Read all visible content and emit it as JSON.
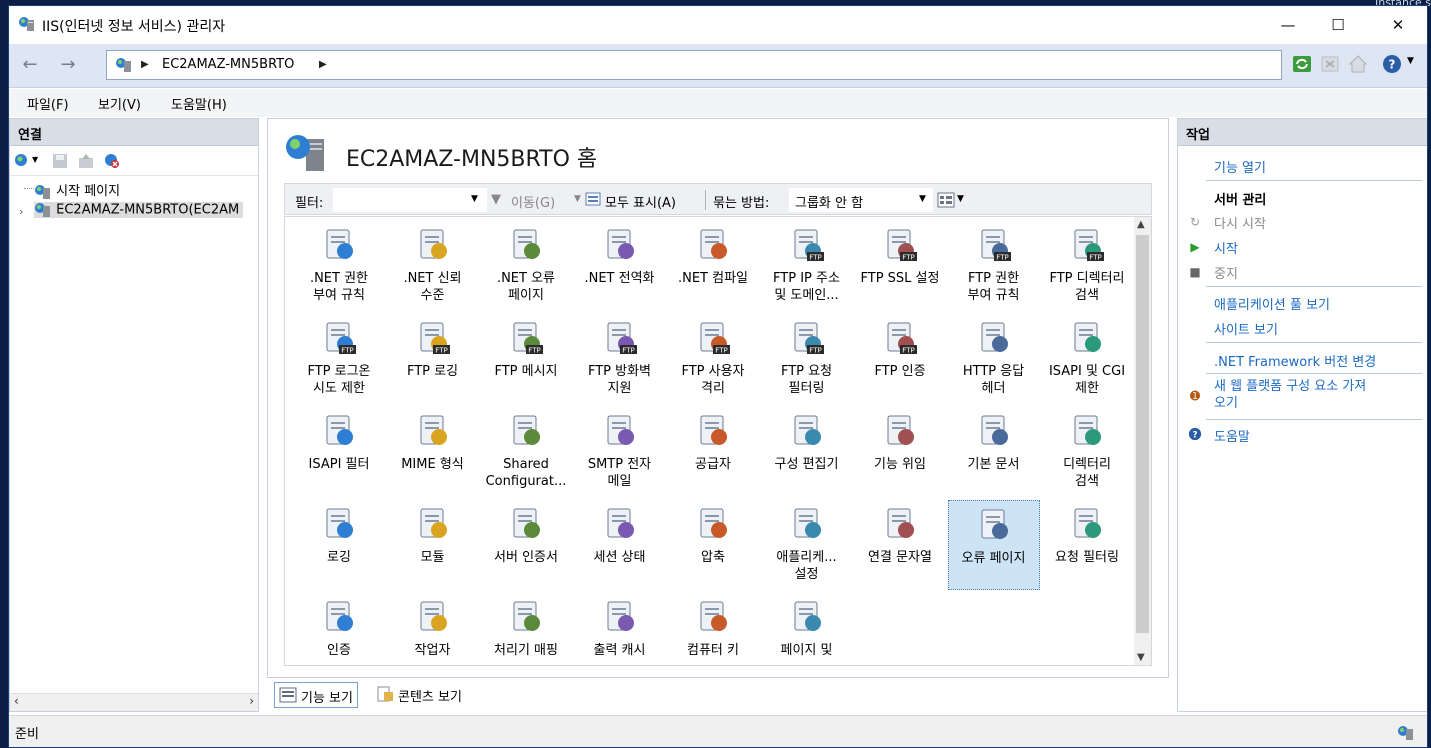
{
  "desktop": {
    "corner_text": "Instance s"
  },
  "window": {
    "title": "IIS(인터넷 정보 서비스) 관리자",
    "controls": {
      "minimize": "—",
      "maximize": "☐",
      "close": "✕"
    }
  },
  "address": {
    "segment": "EC2AMAZ-MN5BRTO"
  },
  "menu": [
    "파일(F)",
    "보기(V)",
    "도움말(H)"
  ],
  "connections": {
    "header": "연결",
    "tree": [
      {
        "label": "시작 페이지"
      },
      {
        "label": "EC2AMAZ-MN5BRTO(EC2AM"
      }
    ]
  },
  "home": {
    "title": "EC2AMAZ-MN5BRTO 홈",
    "filter": {
      "filter_label": "필터:",
      "go_label": "이동(G)",
      "show_all_label": "모두 표시(A)",
      "group_label": "묶는 방법:",
      "group_value": "그룹화 안 함"
    },
    "features": [
      {
        "label": ".NET 권한\n부여 규칙",
        "icon": "lock-doc-icon"
      },
      {
        "label": ".NET 신뢰\n수준",
        "icon": "globe-check-icon"
      },
      {
        "label": ".NET 오류\n페이지",
        "icon": "error-404-icon"
      },
      {
        "label": ".NET 전역화",
        "icon": "globe-icon"
      },
      {
        "label": ".NET 컴파일",
        "icon": "compile-icon"
      },
      {
        "label": "FTP IP 주소\n및 도메인...",
        "icon": "ftp-ip-icon"
      },
      {
        "label": "FTP SSL 설정",
        "icon": "ftp-ssl-icon"
      },
      {
        "label": "FTP 권한\n부여 규칙",
        "icon": "ftp-key-icon"
      },
      {
        "label": "FTP 디렉터리\n검색",
        "icon": "ftp-dir-icon"
      },
      {
        "label": "FTP 로그온\n시도 제한",
        "icon": "ftp-logon-icon"
      },
      {
        "label": "FTP 로깅",
        "icon": "ftp-log-icon"
      },
      {
        "label": "FTP 메시지",
        "icon": "ftp-msg-icon"
      },
      {
        "label": "FTP 방화벽\n지원",
        "icon": "ftp-firewall-icon"
      },
      {
        "label": "FTP 사용자\n격리",
        "icon": "ftp-user-icon"
      },
      {
        "label": "FTP 요청\n필터링",
        "icon": "ftp-filter-icon"
      },
      {
        "label": "FTP 인증",
        "icon": "ftp-auth-icon"
      },
      {
        "label": "HTTP 응답\n헤더",
        "icon": "http-header-icon"
      },
      {
        "label": "ISAPI 및 CGI\n제한",
        "icon": "isapi-cgi-icon"
      },
      {
        "label": "ISAPI 필터",
        "icon": "isapi-filter-icon"
      },
      {
        "label": "MIME 형식",
        "icon": "mime-icon"
      },
      {
        "label": "Shared\nConfigurat...",
        "icon": "shared-config-icon"
      },
      {
        "label": "SMTP 전자\n메일",
        "icon": "smtp-icon"
      },
      {
        "label": "공급자",
        "icon": "provider-icon"
      },
      {
        "label": "구성 편집기",
        "icon": "config-editor-icon"
      },
      {
        "label": "기능 위임",
        "icon": "delegation-icon"
      },
      {
        "label": "기본 문서",
        "icon": "default-doc-icon"
      },
      {
        "label": "디렉터리\n검색",
        "icon": "dir-browse-icon"
      },
      {
        "label": "로깅",
        "icon": "logging-icon"
      },
      {
        "label": "모듈",
        "icon": "modules-icon"
      },
      {
        "label": "서버 인증서",
        "icon": "certificate-icon"
      },
      {
        "label": "세션 상태",
        "icon": "session-icon"
      },
      {
        "label": "압축",
        "icon": "compression-icon"
      },
      {
        "label": "애플리케...\n설정",
        "icon": "app-settings-icon"
      },
      {
        "label": "연결 문자열",
        "icon": "connection-string-icon"
      },
      {
        "label": "오류 페이지",
        "icon": "error-pages-icon",
        "selected": true
      },
      {
        "label": "요청 필터링",
        "icon": "request-filter-icon"
      },
      {
        "label": "인증",
        "icon": "authentication-icon"
      },
      {
        "label": "작업자",
        "icon": "worker-icon"
      },
      {
        "label": "처리기 매핑",
        "icon": "handler-icon"
      },
      {
        "label": "출력 캐시",
        "icon": "output-cache-icon"
      },
      {
        "label": "컴퓨터 키",
        "icon": "machine-key-icon"
      },
      {
        "label": "페이지 및",
        "icon": "pages-controls-icon"
      }
    ]
  },
  "view_tabs": {
    "features": "기능 보기",
    "content": "콘텐츠 보기"
  },
  "actions": {
    "header": "작업",
    "open_feature": "기능 열기",
    "server_manage": "서버 관리",
    "restart": "다시 시작",
    "start": "시작",
    "stop": "중지",
    "view_pools": "애플리케이션 풀 보기",
    "view_sites": "사이트 보기",
    "net_version": ".NET Framework 버전 변경",
    "new_platform": "새 웹 플랫폼 구성 요소 가져\n오기",
    "help": "도움말"
  },
  "status": {
    "text": "준비"
  },
  "colors": {
    "link": "#1d6ac2",
    "panel_header": "#d9dee6",
    "address_bg": "#dde6f2",
    "selection": "#cde4f7"
  }
}
